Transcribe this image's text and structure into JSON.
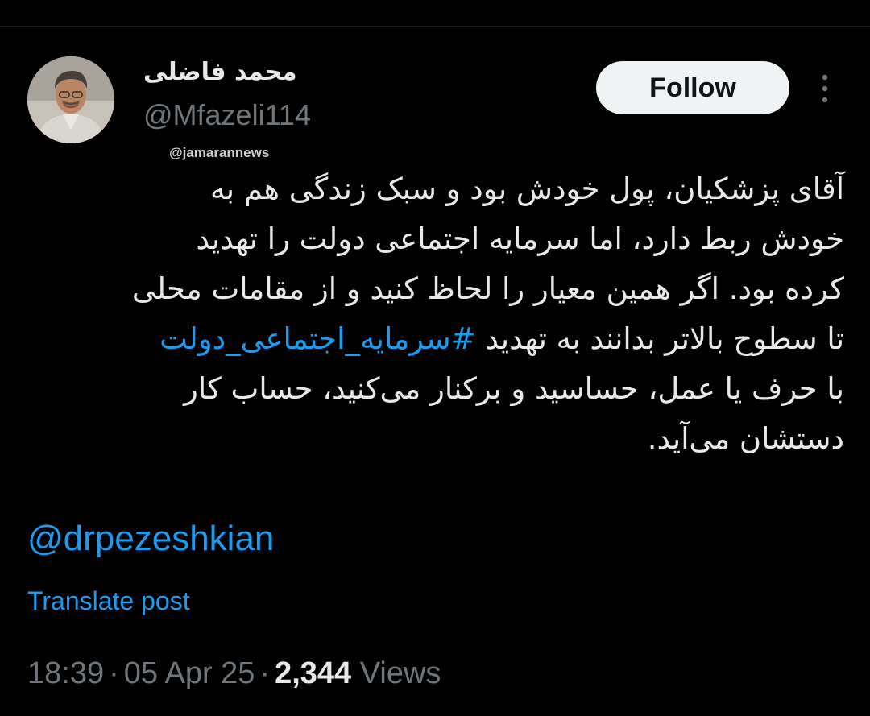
{
  "author": {
    "display_name": "محمد فاضلی",
    "handle": "@Mfazeli114"
  },
  "actions": {
    "follow_label": "Follow",
    "more_icon": "more-vertical-icon"
  },
  "watermark": "@jamarannews",
  "tweet": {
    "lines": [
      {
        "text": "آقای پزشکیان، پول خودش بود و سبک زندگی هم به"
      },
      {
        "text": "خودش ربط دارد، اما سرمایه اجتماعی دولت را تهدید"
      },
      {
        "text": "کرده بود. اگر همین معیار را لحاظ کنید و از مقامات محلی"
      },
      {
        "text": "تا سطوح بالاتر بدانند به تهدید ",
        "hashtag": "#سرمایه_اجتماعی_دولت"
      },
      {
        "text": "با حرف یا عمل، حساسید و برکنار می‌کنید، حساب کار"
      },
      {
        "text": "دستشان می‌آید."
      }
    ],
    "mention": "@drpezeshkian",
    "translate_label": "Translate post"
  },
  "meta": {
    "time": "18:39",
    "separator": "·",
    "date": "05 Apr 25",
    "views_count": "2,344",
    "views_label": "Views"
  },
  "colors": {
    "background": "#000000",
    "text": "#e7e9ea",
    "muted": "#71767b",
    "link": "#1d9bf0",
    "follow_bg": "#eff3f4"
  }
}
